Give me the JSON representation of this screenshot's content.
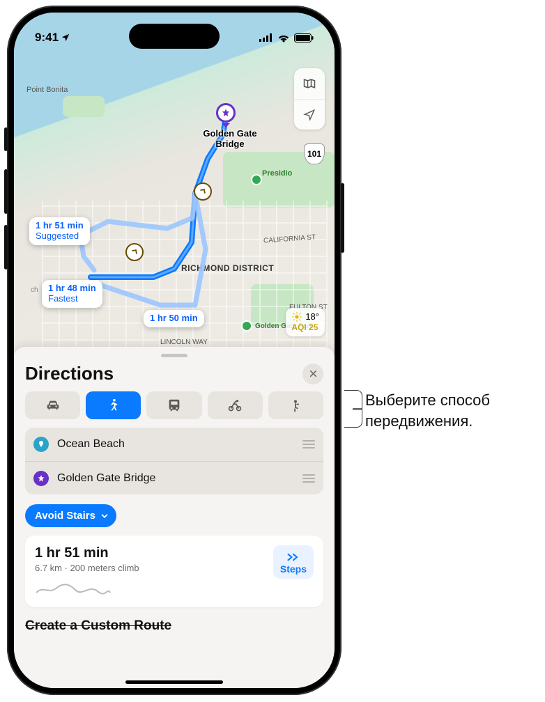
{
  "status": {
    "time": "9:41"
  },
  "map": {
    "labels": {
      "point_bonita": "Point Bonita",
      "presidio": "Presidio",
      "richmond": "RICHMOND DISTRICT",
      "california": "CALIFORNIA ST",
      "fulton": "FULTON ST",
      "lincoln": "LINCOLN WAY",
      "ggpark": "Golden Gate Park",
      "shield101": "101",
      "ch": "ch"
    },
    "destination": "Golden Gate\nBridge",
    "callouts": {
      "suggested_time": "1 hr 51 min",
      "suggested_sub": "Suggested",
      "fastest_time": "1 hr 48 min",
      "fastest_sub": "Fastest",
      "alt_time": "1 hr 50 min"
    },
    "weather": {
      "temp": "18°",
      "aqi": "AQI 25"
    }
  },
  "sheet": {
    "title": "Directions",
    "modes": [
      "drive",
      "walk",
      "transit",
      "cycle",
      "rideshare"
    ],
    "waypoints": {
      "start": "Ocean Beach",
      "end": "Golden Gate Bridge"
    },
    "avoid_label": "Avoid Stairs",
    "route": {
      "time": "1 hr 51 min",
      "sub": "6.7 km · 200 meters climb",
      "steps_label": "Steps"
    },
    "custom": "Create a Custom Route"
  },
  "annotation": {
    "line1": "Выберите способ",
    "line2": "передвижения."
  }
}
